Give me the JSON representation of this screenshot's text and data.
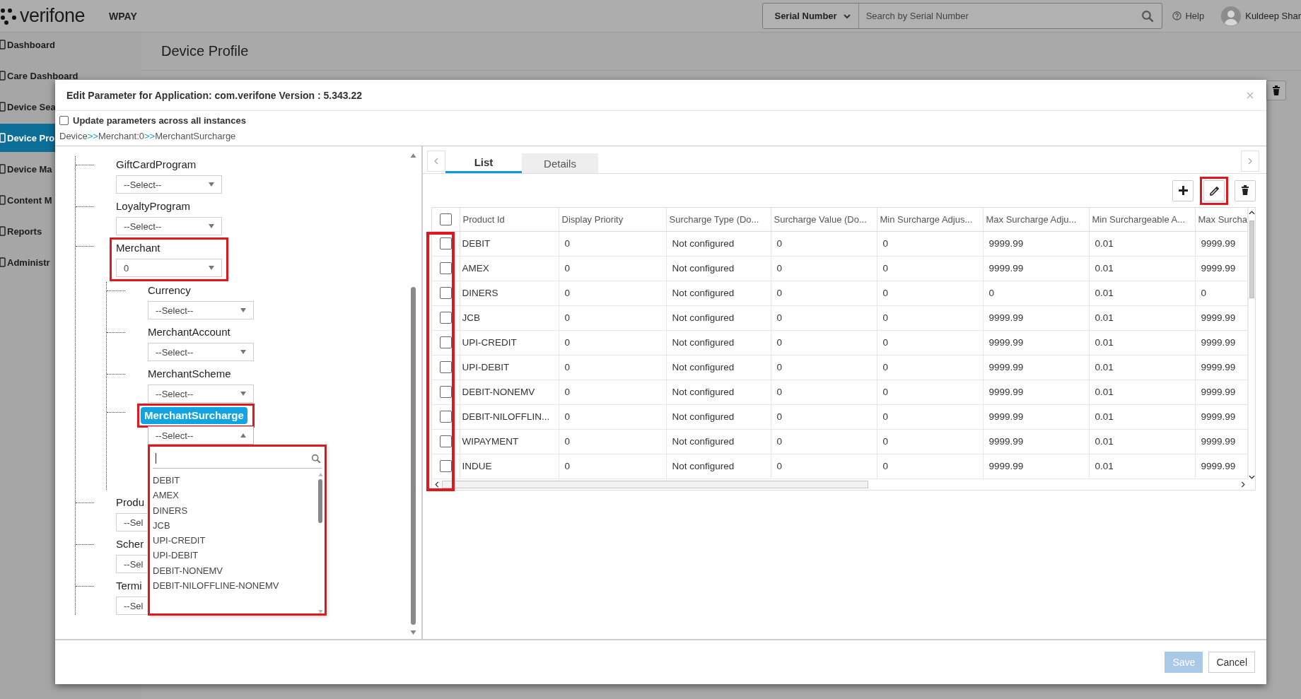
{
  "top_bar": {
    "logo": "verifone",
    "app_name": "WPAY",
    "search_scope": "Serial Number",
    "search": {
      "placeholder": "Search by Serial Number"
    },
    "help": "Help",
    "user": "Kuldeep Shar"
  },
  "sidebar": {
    "items": [
      {
        "label": "Dashboard",
        "selected": false
      },
      {
        "label": "Care Dashboard",
        "selected": false
      },
      {
        "label": "Device Sea",
        "selected": false
      },
      {
        "label": "Device Pro",
        "selected": true
      },
      {
        "label": "Device Ma",
        "selected": false
      },
      {
        "label": "Content M",
        "selected": false
      },
      {
        "label": "Reports",
        "selected": false
      },
      {
        "label": "Administr",
        "selected": false
      }
    ]
  },
  "page": {
    "title": "Device Profile"
  },
  "dialog": {
    "title": "Edit Parameter for Application: com.verifone Version : 5.343.22",
    "update_all": {
      "label": "Update parameters across all instances",
      "checked": false
    },
    "breadcrumb": [
      {
        "kind": "crumb",
        "text": "Device"
      },
      {
        "kind": "separator",
        "text": ">>"
      },
      {
        "kind": "crumb",
        "text": "Merchant:0"
      },
      {
        "kind": "separator",
        "text": ">>"
      },
      {
        "kind": "crumb",
        "text": "MerchantSurcharge"
      }
    ],
    "tree": [
      {
        "label": "GiftCardProgram",
        "value": "--Select--",
        "kind": "full",
        "selected": false,
        "open": false,
        "highlighted": false,
        "label_highlighted": false
      },
      {
        "label": "LoyaltyProgram",
        "value": "--Select--",
        "kind": "full",
        "selected": false,
        "open": false,
        "highlighted": false,
        "label_highlighted": false
      },
      {
        "label": "Merchant",
        "value": "0",
        "kind": "full",
        "selected": false,
        "open": false,
        "highlighted": true,
        "label_highlighted": false,
        "children": [
          {
            "label": "Currency",
            "value": "--Select--",
            "kind": "full",
            "selected": false,
            "open": false,
            "highlighted": false,
            "label_highlighted": false
          },
          {
            "label": "MerchantAccount",
            "value": "--Select--",
            "kind": "full",
            "selected": false,
            "open": false,
            "highlighted": false,
            "label_highlighted": false
          },
          {
            "label": "MerchantScheme",
            "value": "--Select--",
            "kind": "full",
            "selected": false,
            "open": false,
            "highlighted": false,
            "label_highlighted": false
          },
          {
            "label": "MerchantSurcharge",
            "value": "--Select--",
            "kind": "full",
            "selected": true,
            "open": true,
            "highlighted": false,
            "label_highlighted": true,
            "dropdown": {
              "highlighted": true,
              "options": [
                "DEBIT",
                "AMEX",
                "DINERS",
                "JCB",
                "UPI-CREDIT",
                "UPI-DEBIT",
                "DEBIT-NONEMV",
                "DEBIT-NILOFFLINE-NONEMV"
              ]
            }
          }
        ]
      },
      {
        "label": "Produ",
        "value": "--Sel",
        "kind": "clipped",
        "selected": false,
        "highlighted": false,
        "label_highlighted": false
      },
      {
        "label": "Scher",
        "value": "--Sel",
        "kind": "clipped",
        "selected": false,
        "highlighted": false,
        "label_highlighted": false
      },
      {
        "label": "Termi",
        "value": "--Sel",
        "kind": "clipped",
        "selected": false,
        "highlighted": false,
        "label_highlighted": false
      }
    ],
    "tabs": [
      {
        "label": "List",
        "selected": true
      },
      {
        "label": "Details",
        "selected": false
      }
    ],
    "toolbar": [
      {
        "kind": "add",
        "highlighted": false
      },
      {
        "kind": "edit",
        "highlighted": true
      },
      {
        "kind": "delete",
        "highlighted": false
      }
    ],
    "table": {
      "select_all": false,
      "checkbox_column_highlighted": true,
      "columns": [
        "Product Id",
        "Display Priority",
        "Surcharge Type (Do...",
        "Surcharge Value (Do...",
        "Min Surcharge Adjus...",
        "Max Surcharge Adju...",
        "Min Surchargeable A...",
        "Max Surcha"
      ],
      "rows": [
        {
          "selected": false,
          "cells": [
            "DEBIT",
            "0",
            "Not configured",
            "0",
            "0",
            "9999.99",
            "0.01",
            "9999.99"
          ]
        },
        {
          "selected": false,
          "cells": [
            "AMEX",
            "0",
            "Not configured",
            "0",
            "0",
            "9999.99",
            "0.01",
            "9999.99"
          ]
        },
        {
          "selected": false,
          "cells": [
            "DINERS",
            "0",
            "Not configured",
            "0",
            "0",
            "0",
            "0.01",
            "0"
          ]
        },
        {
          "selected": false,
          "cells": [
            "JCB",
            "0",
            "Not configured",
            "0",
            "0",
            "9999.99",
            "0.01",
            "9999.99"
          ]
        },
        {
          "selected": false,
          "cells": [
            "UPI-CREDIT",
            "0",
            "Not configured",
            "0",
            "0",
            "9999.99",
            "0.01",
            "9999.99"
          ]
        },
        {
          "selected": false,
          "cells": [
            "UPI-DEBIT",
            "0",
            "Not configured",
            "0",
            "0",
            "9999.99",
            "0.01",
            "9999.99"
          ]
        },
        {
          "selected": false,
          "cells": [
            "DEBIT-NONEMV",
            "0",
            "Not configured",
            "0",
            "0",
            "9999.99",
            "0.01",
            "9999.99"
          ]
        },
        {
          "selected": false,
          "cells": [
            "DEBIT-NILOFFLIN...",
            "0",
            "Not configured",
            "0",
            "0",
            "9999.99",
            "0.01",
            "9999.99"
          ]
        },
        {
          "selected": false,
          "cells": [
            "WIPAYMENT",
            "0",
            "Not configured",
            "0",
            "0",
            "9999.99",
            "0.01",
            "9999.99"
          ]
        },
        {
          "selected": false,
          "cells": [
            "INDUE",
            "0",
            "Not configured",
            "0",
            "0",
            "9999.99",
            "0.01",
            "9999.99"
          ]
        }
      ]
    },
    "buttons": [
      {
        "label": "Save",
        "disabled": true
      },
      {
        "label": "Cancel",
        "disabled": false
      }
    ]
  }
}
